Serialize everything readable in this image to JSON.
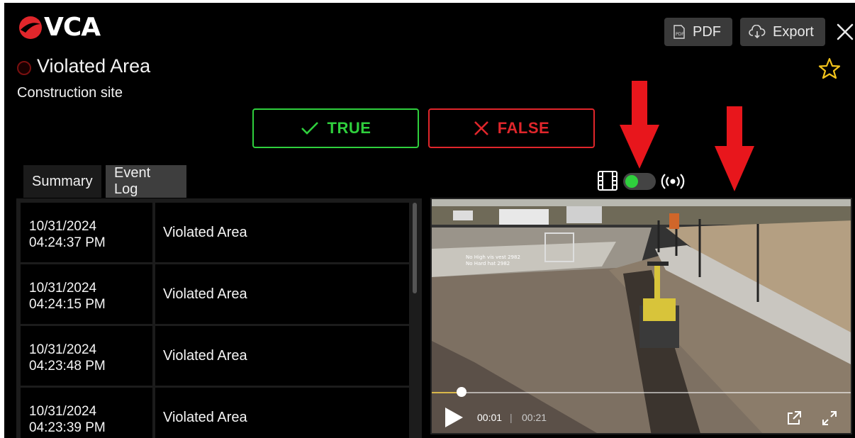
{
  "app": {
    "logo_text": "VCA",
    "brand_color": "#e0262b"
  },
  "toolbar": {
    "pdf_label": "PDF",
    "export_label": "Export"
  },
  "event": {
    "title": "Violated Area",
    "location": "Construction site"
  },
  "verdict": {
    "true_label": "TRUE",
    "false_label": "FALSE",
    "true_color": "#2fcf3d",
    "false_color": "#e0262b"
  },
  "tabs": [
    {
      "label": "Summary",
      "active": false
    },
    {
      "label": "Event Log",
      "active": true
    }
  ],
  "event_log": [
    {
      "date": "10/31/2024",
      "time": "04:24:37 PM",
      "name": "Violated Area"
    },
    {
      "date": "10/31/2024",
      "time": "04:24:15 PM",
      "name": "Violated Area"
    },
    {
      "date": "10/31/2024",
      "time": "04:23:48 PM",
      "name": "Violated Area"
    },
    {
      "date": "10/31/2024",
      "time": "04:23:39 PM",
      "name": "Violated Area"
    }
  ],
  "video": {
    "toggle_on": true,
    "current_time": "00:01",
    "separator": "|",
    "total_time": "00:21",
    "progress_fraction": 0.07,
    "overlay_line1": "No High vis vest 2982",
    "overlay_line2": "No Hard hat 2982"
  },
  "icons": {
    "close": "close-icon",
    "star": "star-icon",
    "pdf": "pdf-icon",
    "export": "cloud-download-icon",
    "film": "film-icon",
    "live": "broadcast-icon",
    "play": "play-icon",
    "popout": "external-link-icon",
    "fullscreen": "fullscreen-icon",
    "annotation": "red-arrow-icon"
  }
}
